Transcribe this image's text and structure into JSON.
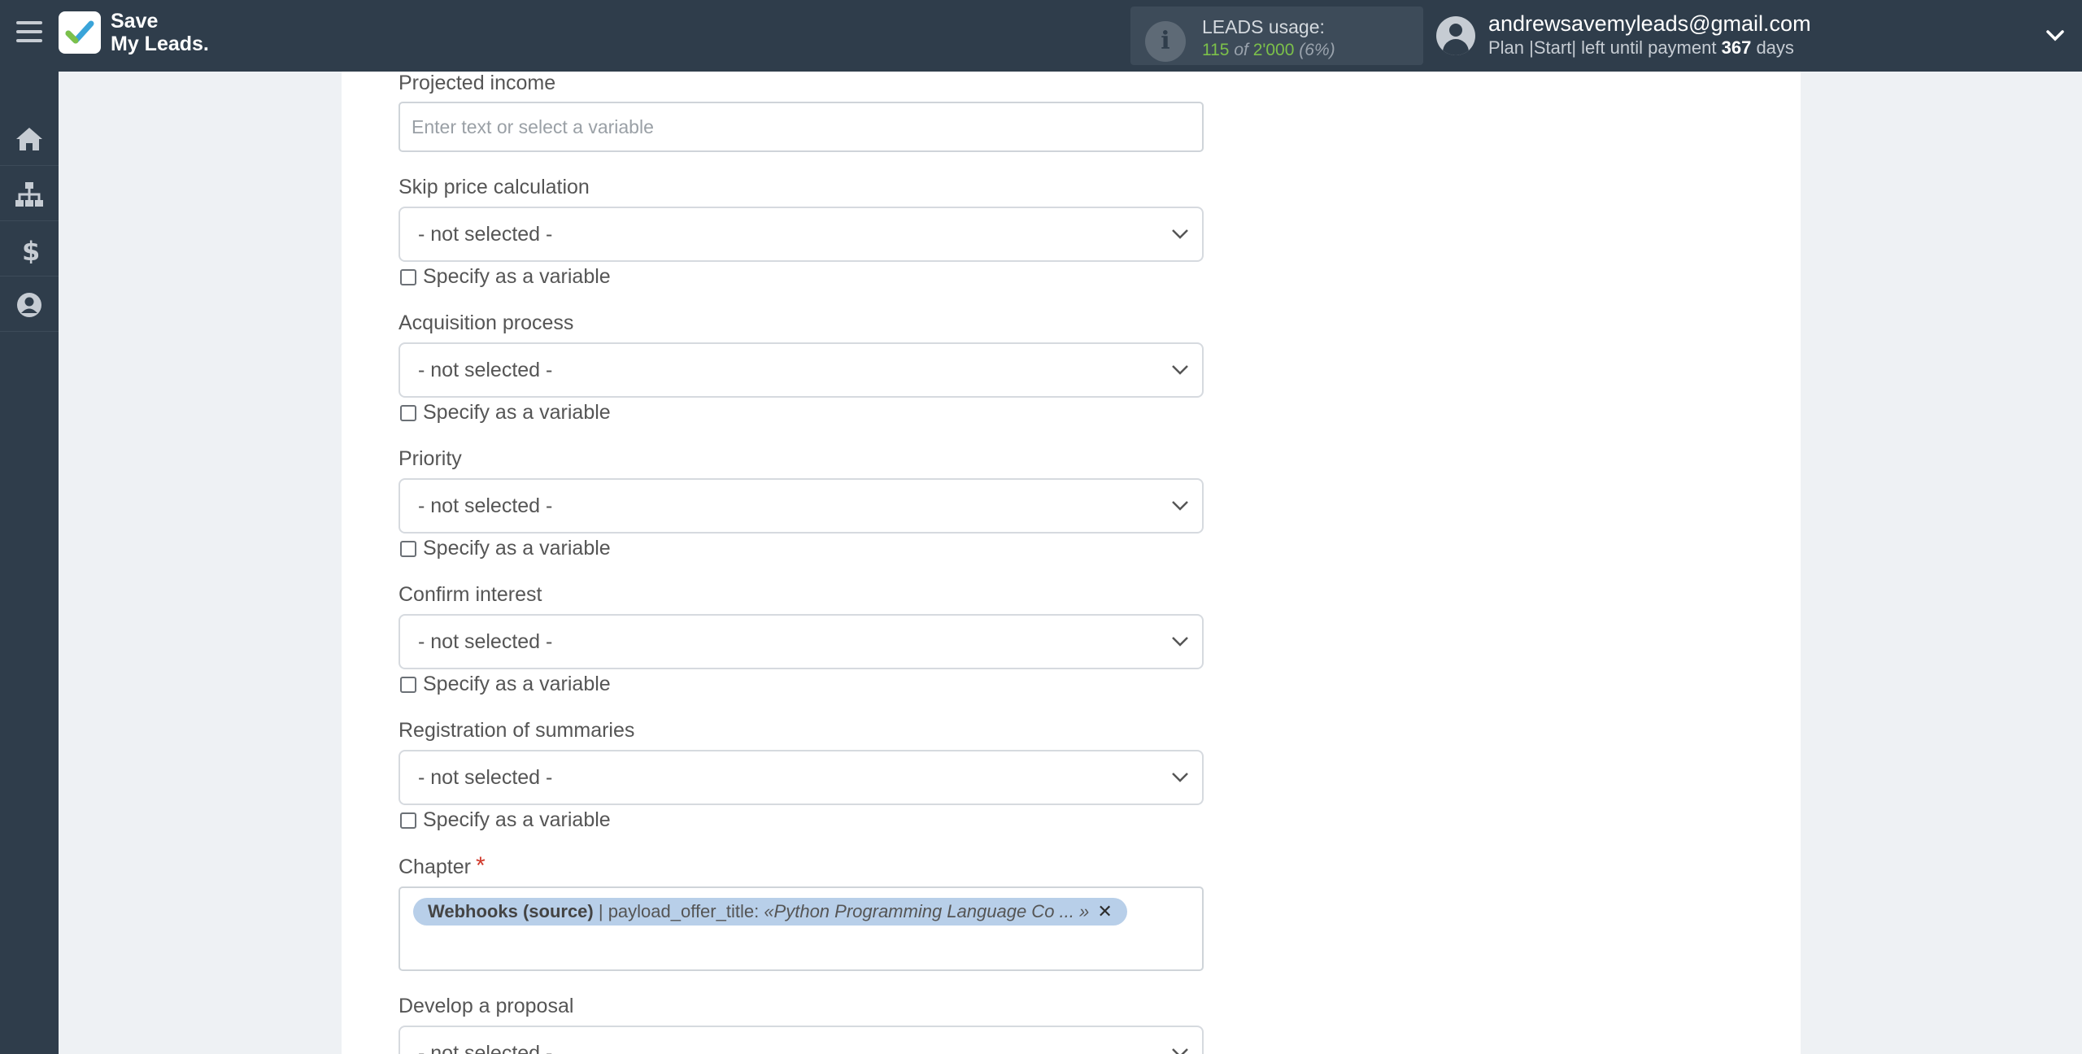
{
  "app": {
    "brand_line1": "Save",
    "brand_line2": "My Leads."
  },
  "usage": {
    "title": "LEADS usage:",
    "used": "115",
    "of": "of",
    "total": "2'000",
    "percent": "(6%)"
  },
  "account": {
    "email": "andrewsavemyleads@gmail.com",
    "plan_prefix": "Plan |Start| left until payment",
    "days": "367",
    "days_suffix": "days"
  },
  "sidebar": {
    "items": [
      {
        "icon": "home-icon"
      },
      {
        "icon": "sitemap-icon"
      },
      {
        "icon": "dollar-icon"
      },
      {
        "icon": "user-circle-icon"
      }
    ]
  },
  "form": {
    "projected_income": {
      "label": "Projected income",
      "placeholder": "Enter text or select a variable"
    },
    "fields": [
      {
        "label": "Skip price calculation",
        "value": "- not selected -",
        "checkbox": "Specify as a variable"
      },
      {
        "label": "Acquisition process",
        "value": "- not selected -",
        "checkbox": "Specify as a variable"
      },
      {
        "label": "Priority",
        "value": "- not selected -",
        "checkbox": "Specify as a variable"
      },
      {
        "label": "Confirm interest",
        "value": "- not selected -",
        "checkbox": "Specify as a variable"
      },
      {
        "label": "Registration of summaries",
        "value": "- not selected -",
        "checkbox": "Specify as a variable"
      }
    ],
    "chapter": {
      "label": "Chapter",
      "required_mark": "*",
      "tag_source": "Webhooks (source)",
      "tag_separator": " | payload_offer_title: ",
      "tag_value": "«Python Programming Language Co ... »",
      "tag_remove": "✕"
    },
    "develop_proposal": {
      "label": "Develop a proposal",
      "value": "- not selected -"
    }
  },
  "colors": {
    "topbar": "#2f3d4b",
    "accent_green": "#7cc04a",
    "tag_bg": "#b8cfe9",
    "required": "#d0392b"
  }
}
